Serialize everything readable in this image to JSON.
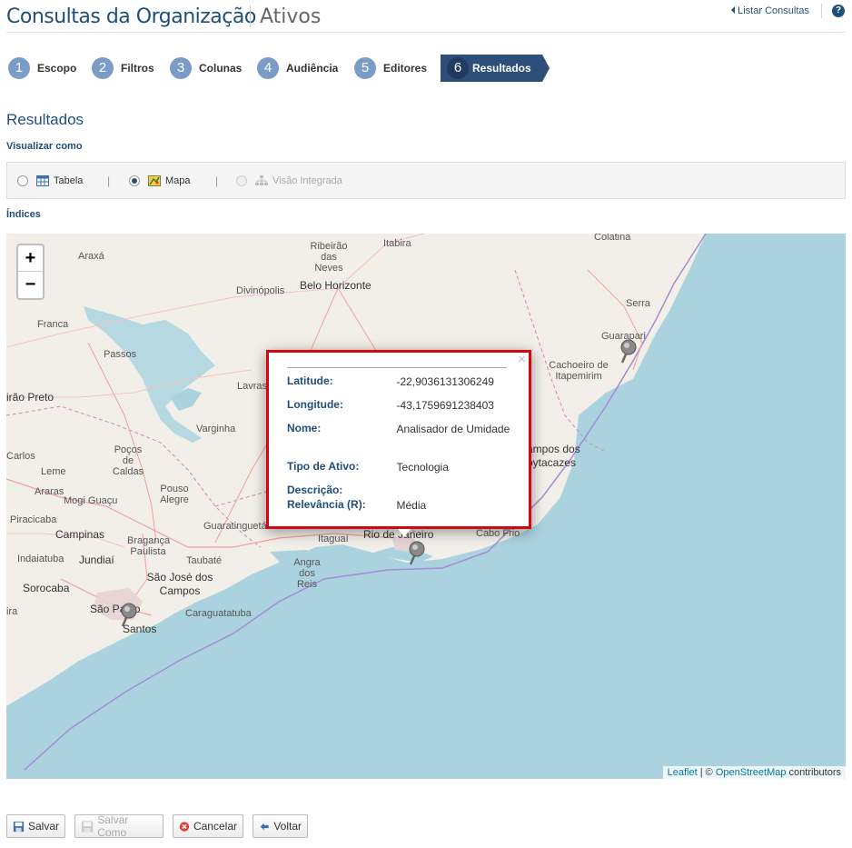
{
  "header": {
    "title": "Consultas da Organização",
    "subtitle": "Ativos",
    "list_link": "Listar Consultas",
    "help": "?"
  },
  "steps": [
    {
      "num": "1",
      "label": "Escopo"
    },
    {
      "num": "2",
      "label": "Filtros"
    },
    {
      "num": "3",
      "label": "Colunas"
    },
    {
      "num": "4",
      "label": "Audiência"
    },
    {
      "num": "5",
      "label": "Editores"
    },
    {
      "num": "6",
      "label": "Resultados"
    }
  ],
  "section_title": "Resultados",
  "view_label": "Visualizar como",
  "view_options": {
    "table": "Tabela",
    "map": "Mapa",
    "integrated": "Visão Integrada",
    "selected": "Mapa"
  },
  "indices_label": "Índices",
  "map": {
    "zoom_in": "+",
    "zoom_out": "−",
    "places": {
      "araxa": "Araxá",
      "ribeirao_neves": "Ribeirão das Neves",
      "itabira": "Itabira",
      "colatina": "Colatina",
      "divinopolis": "Divinópolis",
      "belo_horizonte": "Belo Horizonte",
      "serra": "Serra",
      "franca": "Franca",
      "guarapari": "Guarapari",
      "passos": "Passos",
      "cachoeiro": "Cachoeiro de Itapemirim",
      "lavras": "Lavras",
      "ribeirao_preto": "irão Preto",
      "varginha": "Varginha",
      "carlos": "Carlos",
      "pocos": "Poços de Caldas",
      "campos": "ampos dos oytacazes",
      "leme": "Leme",
      "pouso_alegre": "Pouso Alegre",
      "araras": "Araras",
      "mogi": "Mogi Guaçu",
      "piracicaba": "Piracicaba",
      "campinas": "Campinas",
      "guaratingueta": "Guaratinguetá",
      "itaguai": "Itaguaí",
      "rio": "Rio de Janeiro",
      "cabo_frio": "Cabo Frio",
      "braganca": "Bragança Paulista",
      "indaiatuba": "Indaiatuba",
      "jundiai": "Jundiaí",
      "taubate": "Taubaté",
      "angra": "Angra dos Reis",
      "sjc": "São José dos Campos",
      "sorocaba": "Sorocaba",
      "sao_paulo": "São Paulo",
      "caraguatatuba": "Caraguatatuba",
      "santos": "Santos",
      "ira": "ira"
    },
    "attribution": {
      "leaflet": "Leaflet",
      "sep": " | © ",
      "osm": "OpenStreetMap",
      "contrib": " contributors"
    }
  },
  "popup": {
    "close": "×",
    "rows": [
      {
        "key": "Latitude:",
        "value": "-22,9036131306249"
      },
      {
        "key": "Longitude:",
        "value": "-43,1759691238403"
      },
      {
        "key": "Nome:",
        "value": "Analisador de Umidade"
      },
      {
        "key": "Tipo de Ativo:",
        "value": "Tecnologia"
      },
      {
        "key": "Descrição:",
        "value": ""
      },
      {
        "key": "Relevância (R):",
        "value": "Média"
      }
    ]
  },
  "buttons": {
    "save": "Salvar",
    "save_as": "Salvar Como",
    "cancel": "Cancelar",
    "back": "Voltar"
  },
  "colors": {
    "brand": "#1f4e79",
    "active_step": "#2c4e78",
    "step_circle": "#7a9cc6",
    "popup_border": "#d4070f",
    "sea": "#aad3df",
    "land": "#f2efe9"
  }
}
